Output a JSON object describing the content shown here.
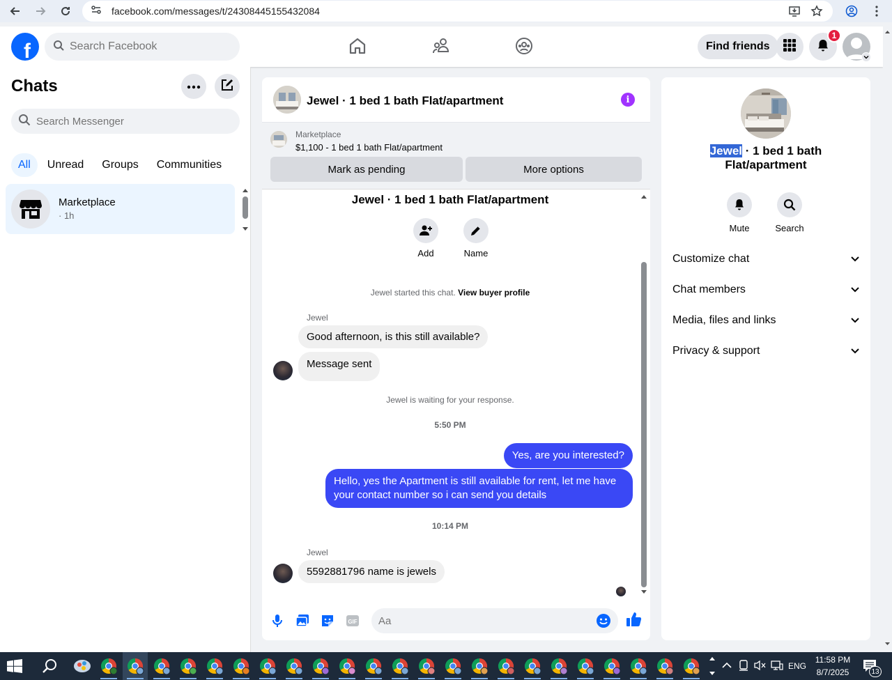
{
  "browser": {
    "url": "facebook.com/messages/t/24308445155432084"
  },
  "header": {
    "search_placeholder": "Search Facebook",
    "find_friends_label": "Find friends",
    "notification_count": "1"
  },
  "chats": {
    "title": "Chats",
    "search_placeholder": "Search Messenger",
    "filters": [
      "All",
      "Unread",
      "Groups",
      "Communities"
    ],
    "active_filter": "All",
    "items": [
      {
        "name": "Marketplace",
        "time": "· 1h"
      }
    ]
  },
  "conversation": {
    "title": "Jewel · 1 bed 1 bath Flat/apartment",
    "marketplace": {
      "label": "Marketplace",
      "price_line": "$1,100 - 1 bed 1 bath Flat/apartment",
      "mark_pending_label": "Mark as pending",
      "more_options_label": "More options"
    },
    "intro": {
      "title": "Jewel · 1 bed 1 bath Flat/apartment",
      "add_label": "Add",
      "name_label": "Name",
      "started_text": "Jewel started this chat.",
      "view_profile_label": "View buyer profile"
    },
    "messages": {
      "sender_1": "Jewel",
      "msg_1": "Good afternoon, is this still available?",
      "msg_2": "Message sent",
      "waiting_text": "Jewel is waiting for your response.",
      "time_1": "5:50 PM",
      "out_1": "Yes, are you interested?",
      "out_2": "Hello, yes the Apartment is still available for rent, let me have your contact number so i can send you details",
      "time_2": "10:14 PM",
      "sender_2": "Jewel",
      "msg_3": "5592881796 name is jewels"
    },
    "composer_placeholder": "Aa"
  },
  "info_panel": {
    "title_highlight": "Jewel",
    "title_rest_1": " · 1 bed 1 bath",
    "title_rest_2": "Flat/apartment",
    "mute_label": "Mute",
    "search_label": "Search",
    "sections": [
      "Customize chat",
      "Chat members",
      "Media, files and links",
      "Privacy & support"
    ]
  },
  "taskbar": {
    "language": "ENG",
    "time": "11:58 PM",
    "date": "8/7/2025",
    "notification_count": "13"
  },
  "colors": {
    "fb_blue": "#0866ff",
    "outgoing_bubble": "#3a48f5",
    "info_purple": "#a033ff",
    "badge_red": "#e41e3f"
  }
}
